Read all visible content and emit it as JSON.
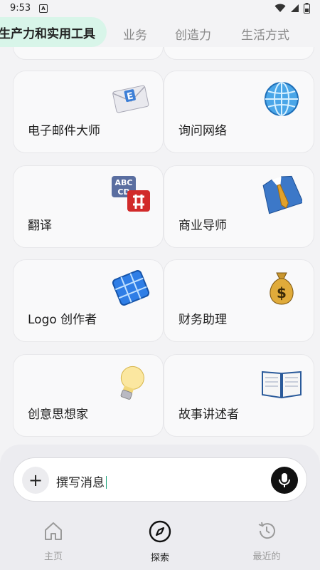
{
  "status": {
    "time": "9:53",
    "notification": "A"
  },
  "tabs": {
    "active": "生产力和实用工具",
    "items": [
      "业务",
      "创造力",
      "生活方式"
    ]
  },
  "cards": [
    {
      "label": "电子邮件大师",
      "icon": "email-icon"
    },
    {
      "label": "询问网络",
      "icon": "globe-icon"
    },
    {
      "label": "翻译",
      "icon": "translate-icon"
    },
    {
      "label": "商业导师",
      "icon": "shirt-tie-icon"
    },
    {
      "label": "Logo 创作者",
      "icon": "logo-grid-icon"
    },
    {
      "label": "财务助理",
      "icon": "money-bag-icon"
    },
    {
      "label": "创意思想家",
      "icon": "lightbulb-icon"
    },
    {
      "label": "故事讲述者",
      "icon": "open-book-icon"
    }
  ],
  "composer": {
    "plus": "+",
    "placeholder": "撰写消息"
  },
  "nav": {
    "home": "主页",
    "explore": "探索",
    "recent": "最近的"
  },
  "icon_text": {
    "abc": "ABC",
    "cd": "CD",
    "e": "E",
    "dollar": "$"
  },
  "colors": {
    "accent": "#d8f5e9",
    "dark": "#111111"
  }
}
